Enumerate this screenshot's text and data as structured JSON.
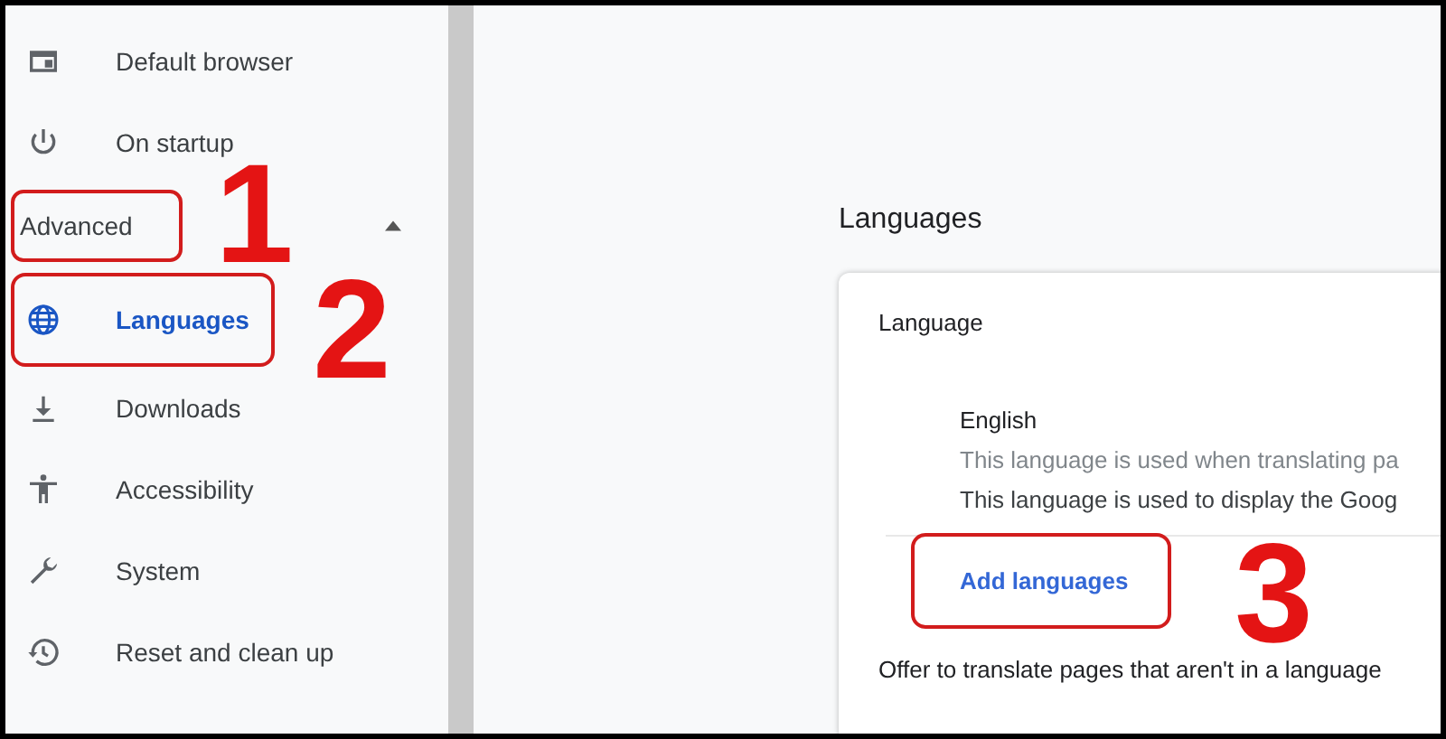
{
  "sidebar": {
    "items": [
      {
        "kind": "item",
        "label": "Default browser",
        "selected": false,
        "highlighted": false
      },
      {
        "kind": "item",
        "label": "On startup",
        "selected": false,
        "highlighted": false
      },
      {
        "kind": "section",
        "label": "Advanced",
        "expanded": true,
        "highlighted": true
      },
      {
        "kind": "item",
        "label": "Languages",
        "selected": true,
        "highlighted": true
      },
      {
        "kind": "item",
        "label": "Downloads",
        "selected": false,
        "highlighted": false
      },
      {
        "kind": "item",
        "label": "Accessibility",
        "selected": false,
        "highlighted": false
      },
      {
        "kind": "item",
        "label": "System",
        "selected": false,
        "highlighted": false
      },
      {
        "kind": "item",
        "label": "Reset and clean up",
        "selected": false,
        "highlighted": false
      }
    ]
  },
  "main": {
    "title": "Languages",
    "card": {
      "heading": "Language",
      "language": {
        "name": "English",
        "lines": [
          "This language is used when translating pa",
          "This language is used to display the Goog"
        ]
      },
      "add_button": {
        "label": "Add languages",
        "highlighted": true
      },
      "offer_text": "Offer to translate pages that aren't in a language"
    }
  },
  "annotations": [
    "1",
    "2",
    "3"
  ]
}
